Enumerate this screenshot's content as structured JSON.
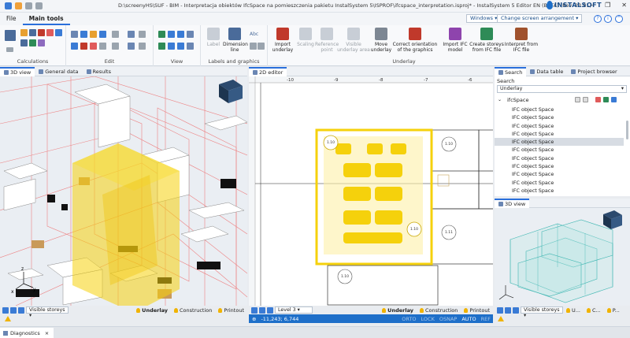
{
  "window": {
    "title": "D:\\screenyHS\\SUF - BIM - Interpretacja obiektów IfcSpace na pomieszczenia pakietu InstalSystem 5\\ISPROF\\ifcspace_interpretation.isproj* - InstalSystem 5 Editor EN (BETA) (Rev. 23.81)",
    "brand": "INSTALSOFT",
    "controls": [
      "–",
      "❐",
      "✕"
    ]
  },
  "menu": {
    "items": [
      "File",
      "Main tools"
    ],
    "active": "Main tools",
    "windows_button": "Windows ▾",
    "arrangement_button": "Change screen arrangement ▾"
  },
  "ribbon": {
    "groups": {
      "calculations": "Calculations",
      "edit": "Edit",
      "view": "View",
      "labels": "Labels and graphics",
      "underlay": "Underlay"
    },
    "buttons": {
      "label": "Label",
      "dimension_line": "Dimension line",
      "abc": "Abc",
      "import_underlay": "Import underlay",
      "scaling": "Scaling",
      "reference_point": "Reference point",
      "visible_underlay_area": "Visible underlay area",
      "move_underlay": "Move underlay",
      "correct_orientation": "Correct orientation of the graphics",
      "import_ifc": "Import IFC model",
      "create_storeys": "Create storeys from IFC file",
      "interpret": "Interpret from IFC file"
    }
  },
  "left_panel": {
    "tabs": [
      "3D view",
      "General data",
      "Results"
    ],
    "active_tab": "3D view",
    "status": {
      "visible_storeys": "Visible storeys",
      "underlay": "Underlay",
      "construction": "Construction",
      "printout": "Printout"
    }
  },
  "editor": {
    "tab": "2D editor",
    "ruler_marks": [
      "-10",
      "-9",
      "-8",
      "-7",
      "-6",
      "-5",
      "-4"
    ],
    "room_labels": [
      "1.10",
      "1.10",
      "1.10",
      "1.11",
      "1.10"
    ],
    "level": "Level 3",
    "status": {
      "underlay": "Underlay",
      "construction": "Construction",
      "printout": "Printout"
    },
    "coords": "-11,243; 6,744",
    "modes": [
      "ORTO",
      "LOCK",
      "OSNAP",
      "AUTO",
      "REF"
    ]
  },
  "right_panel": {
    "tabs": [
      "Search",
      "Data table",
      "Project browser"
    ],
    "active_tab": "Search",
    "search_label": "Search",
    "search_value": "Underlay",
    "tree_root": "ifcSpace",
    "items": [
      "IFC object Space",
      "IFC object Space",
      "IFC object Space",
      "IFC object Space",
      "IFC object Space",
      "IFC object Space",
      "IFC object Space",
      "IFC object Space",
      "IFC object Space",
      "IFC object Space",
      "IFC object Space"
    ],
    "selected_index": 4,
    "mini_view": {
      "tab": "3D view",
      "status_visible": "Visible storeys",
      "status_u": "U...",
      "status_c": "C...",
      "status_p": "P..."
    }
  },
  "bottom": {
    "diagnostics": "Diagnostics"
  },
  "colors": {
    "accent": "#2a6fdb",
    "selection_yellow": "#f5d10c",
    "room_red": "#e05b5b",
    "teal": "#3fb6b2"
  }
}
